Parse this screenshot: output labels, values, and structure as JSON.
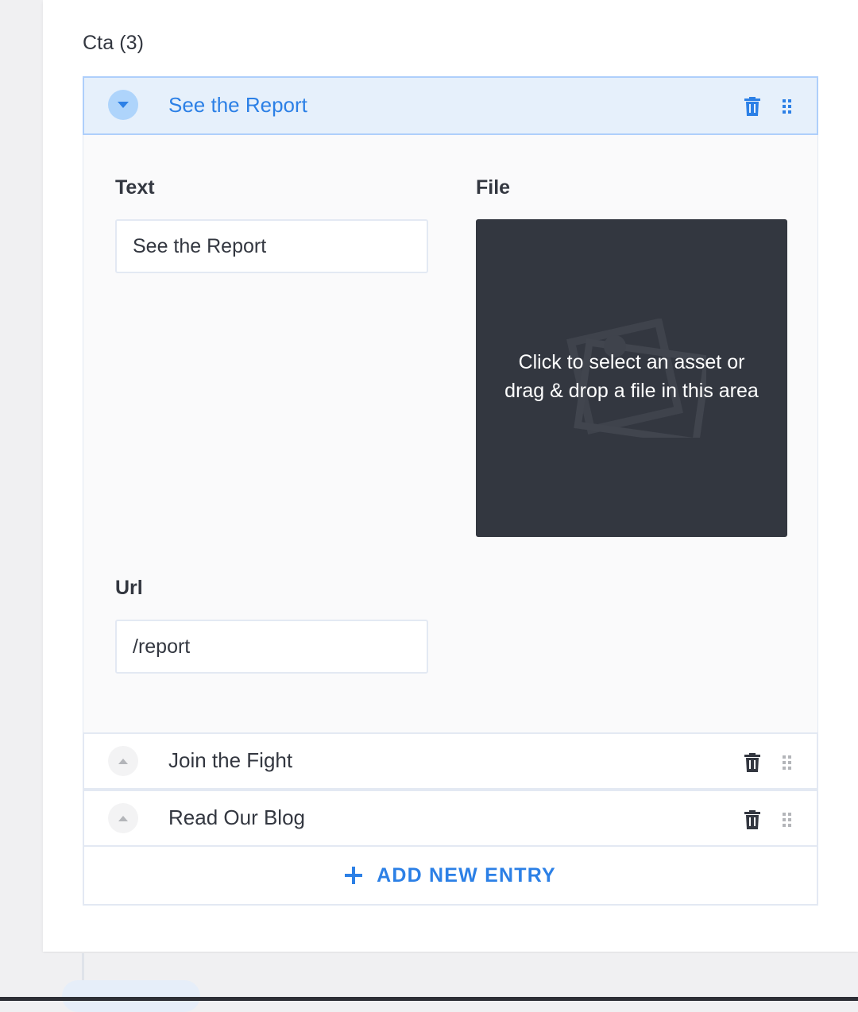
{
  "section": {
    "title": "Cta (3)"
  },
  "entries": [
    {
      "title": "See the Report",
      "expanded": true
    },
    {
      "title": "Join the Fight",
      "expanded": false
    },
    {
      "title": "Read Our Blog",
      "expanded": false
    }
  ],
  "form": {
    "text_label": "Text",
    "text_value": "See the Report",
    "file_label": "File",
    "file_dropzone_line1": "Click to select an asset or",
    "file_dropzone_line2": "drag & drop a file in this area",
    "url_label": "Url",
    "url_value": "/report"
  },
  "actions": {
    "add_new_entry": "ADD NEW ENTRY"
  },
  "icons": {
    "toggle": "caret-icon",
    "delete": "trash-icon",
    "drag": "drag-handle-icon",
    "add": "plus-icon",
    "file_placeholder": "image-placeholder-icon"
  },
  "colors": {
    "accent": "#2c80e6",
    "header_bg": "#e6f0fb",
    "header_border": "#aecffb",
    "dropzone_bg": "#333740",
    "text": "#333740"
  }
}
